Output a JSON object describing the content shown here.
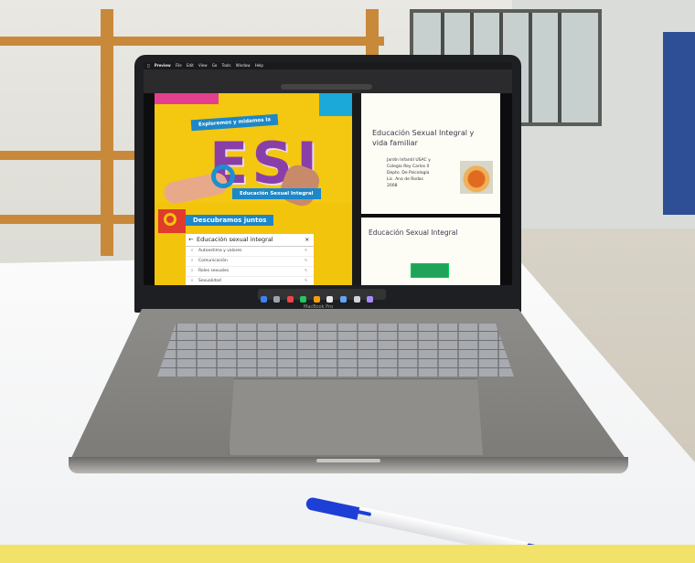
{
  "menubar": {
    "apple": "",
    "items": [
      "Preview",
      "File",
      "Edit",
      "View",
      "Go",
      "Tools",
      "Window",
      "Help"
    ]
  },
  "slide_esi": {
    "heading_top": "Exploremos y midamos la",
    "big_letters": "ESI",
    "subtitle": "Educación Sexual Integral",
    "section_title": "Descubramos juntos",
    "search_title": "Educación sexual integral",
    "search_items": [
      "Autoestima y valores",
      "Comunicación",
      "Roles sexuales",
      "Sexualidad"
    ]
  },
  "slide_right_1": {
    "title": "Educación Sexual Integral y vida familiar",
    "lines": [
      "Jardín Infantil USAC y",
      "Colegio Rey Carlos II",
      "Depto. De Psicología",
      "Lic. Ana de Rodas",
      "2008"
    ]
  },
  "slide_right_2": {
    "title": "Educación Sexual Integral"
  },
  "laptop": {
    "brand_label": "MacBook Pro"
  },
  "colors": {
    "esi_yellow": "#f3c40c",
    "esi_purple": "#8a3fa8",
    "ribbon_blue": "#1c87c9",
    "pen_blue": "#1d3fd6",
    "footer_yellow": "#f3e26a"
  }
}
